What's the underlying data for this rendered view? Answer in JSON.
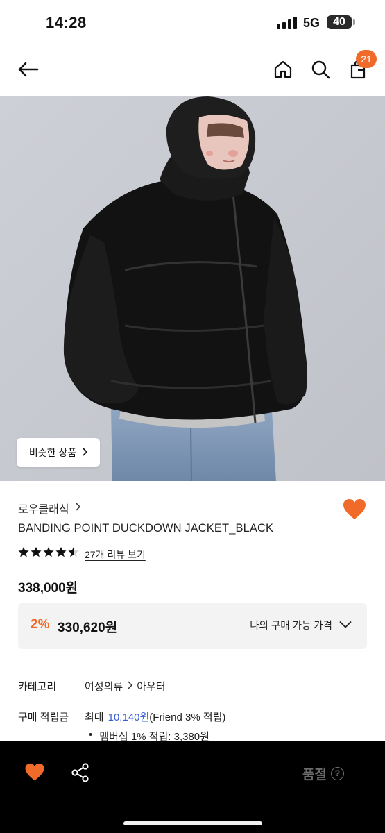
{
  "status_bar": {
    "time": "14:28",
    "network": "5G",
    "battery": "40"
  },
  "nav": {
    "cart_count": "21"
  },
  "hero": {
    "similar_label": "비슷한 상품"
  },
  "product": {
    "brand": "로우클래식",
    "name": "BANDING POINT DUCKDOWN JACKET_BLACK",
    "rating": 4.5,
    "review_link": "27개 리뷰 보기",
    "price": "338,000원",
    "member_discount_pct": "2%",
    "member_price": "330,620원",
    "member_price_label": "나의 구매 가능 가격"
  },
  "info": {
    "category_key": "카테고리",
    "category_1": "여성의류",
    "category_2": "아우터",
    "points_key": "구매 적립금",
    "points_prefix": "최대",
    "points_value": "10,140원",
    "points_suffix": "(Friend 3% 적립)",
    "bullet_text": "멤버십 1% 적립: 3,380원"
  },
  "bottom": {
    "soldout_label": "품절"
  },
  "colors": {
    "accent": "#f06a2a",
    "link_blue": "#3b5fd3",
    "bar": "#000000"
  },
  "icons": [
    "back-arrow-icon",
    "home-icon",
    "search-icon",
    "cart-icon",
    "heart-icon",
    "share-icon",
    "question-icon",
    "chevron-right-icon",
    "chevron-down-icon"
  ]
}
